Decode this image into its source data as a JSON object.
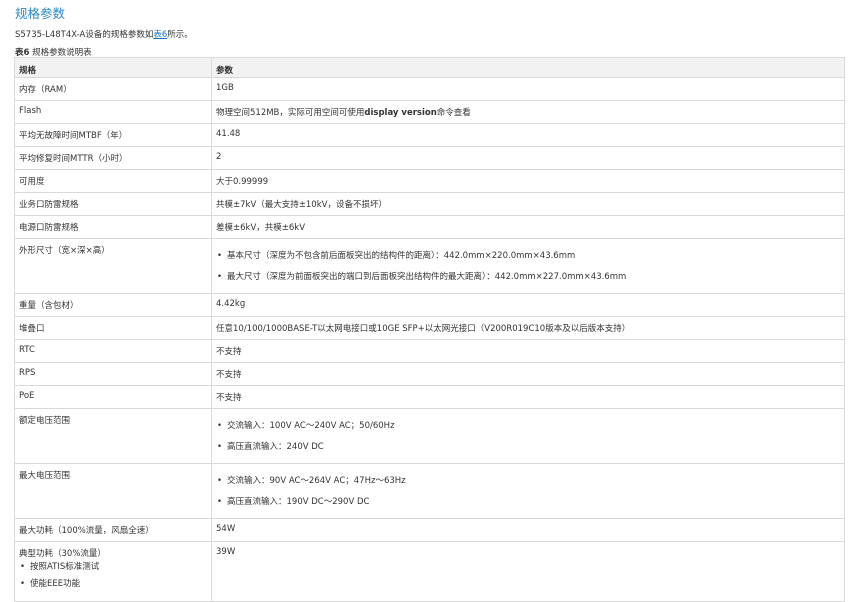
{
  "heading": "规格参数",
  "intro": {
    "before": "S5735-L48T4X-A设备的规格参数如",
    "link": "表6",
    "after": "所示。"
  },
  "caption": {
    "label": "表6",
    "text": " 规格参数说明表"
  },
  "table": {
    "headers": [
      "规格",
      "参数"
    ],
    "rows": [
      {
        "spec": "内存（RAM）",
        "value": "1GB"
      },
      {
        "spec": "Flash",
        "value_before": "物理空间512MB，实际可用空间可使用",
        "value_bold": "display version",
        "value_after": "命令查看"
      },
      {
        "spec": "平均无故障时间MTBF（年）",
        "value": "41.48"
      },
      {
        "spec": "平均修复时间MTTR（小时）",
        "value": "2"
      },
      {
        "spec": "可用度",
        "value": "大于0.99999"
      },
      {
        "spec": "业务口防雷规格",
        "value": "共模±7kV（最大支持±10kV，设备不损坏）"
      },
      {
        "spec": "电源口防雷规格",
        "value": "差模±6kV，共模±6kV"
      },
      {
        "spec": "外形尺寸（宽×深×高）",
        "items": [
          "基本尺寸（深度为不包含前后面板突出的结构件的距离）：442.0mm×220.0mm×43.6mm",
          "最大尺寸（深度为前面板突出的端口到后面板突出结构件的最大距离）：442.0mm×227.0mm×43.6mm"
        ]
      },
      {
        "spec": "重量（含包材）",
        "value": "4.42kg"
      },
      {
        "spec": "堆叠口",
        "value": "任意10/100/1000BASE-T以太网电接口或10GE SFP+以太网光接口（V200R019C10版本及以后版本支持）"
      },
      {
        "spec": "RTC",
        "value": "不支持"
      },
      {
        "spec": "RPS",
        "value": "不支持"
      },
      {
        "spec": "PoE",
        "value": "不支持"
      },
      {
        "spec": "额定电压范围",
        "items": [
          "交流输入：100V AC～240V AC；50/60Hz",
          "高压直流输入：240V DC"
        ]
      },
      {
        "spec": "最大电压范围",
        "items": [
          "交流输入：90V AC～264V AC；47Hz～63Hz",
          "高压直流输入：190V DC～290V DC"
        ]
      },
      {
        "spec": "最大功耗（100%流量，风扇全速）",
        "value": "54W"
      },
      {
        "spec": "典型功耗（30%流量）",
        "spec_items": [
          "按照ATIS标准测试",
          "使能EEE功能"
        ],
        "value": "39W"
      }
    ]
  }
}
